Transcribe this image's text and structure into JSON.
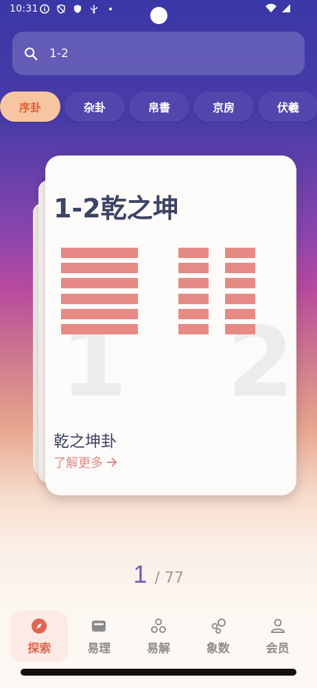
{
  "status": {
    "time": "10:31"
  },
  "search": {
    "value": "1-2"
  },
  "tabs": [
    {
      "label": "序卦"
    },
    {
      "label": "杂卦"
    },
    {
      "label": "帛書"
    },
    {
      "label": "京房"
    },
    {
      "label": "伏羲"
    }
  ],
  "card": {
    "title": "1-2乾之坤",
    "subtitle": "乾之坤卦",
    "more": "了解更多",
    "num_left": "1",
    "num_right": "2"
  },
  "pager": {
    "current": "1",
    "total_text": "/ 77"
  },
  "nav": [
    {
      "label": "探索",
      "icon": "compass-icon"
    },
    {
      "label": "易理",
      "icon": "wallet-icon"
    },
    {
      "label": "易解",
      "icon": "circles-icon"
    },
    {
      "label": "象数",
      "icon": "bubbles-icon"
    },
    {
      "label": "会员",
      "icon": "person-icon"
    }
  ]
}
